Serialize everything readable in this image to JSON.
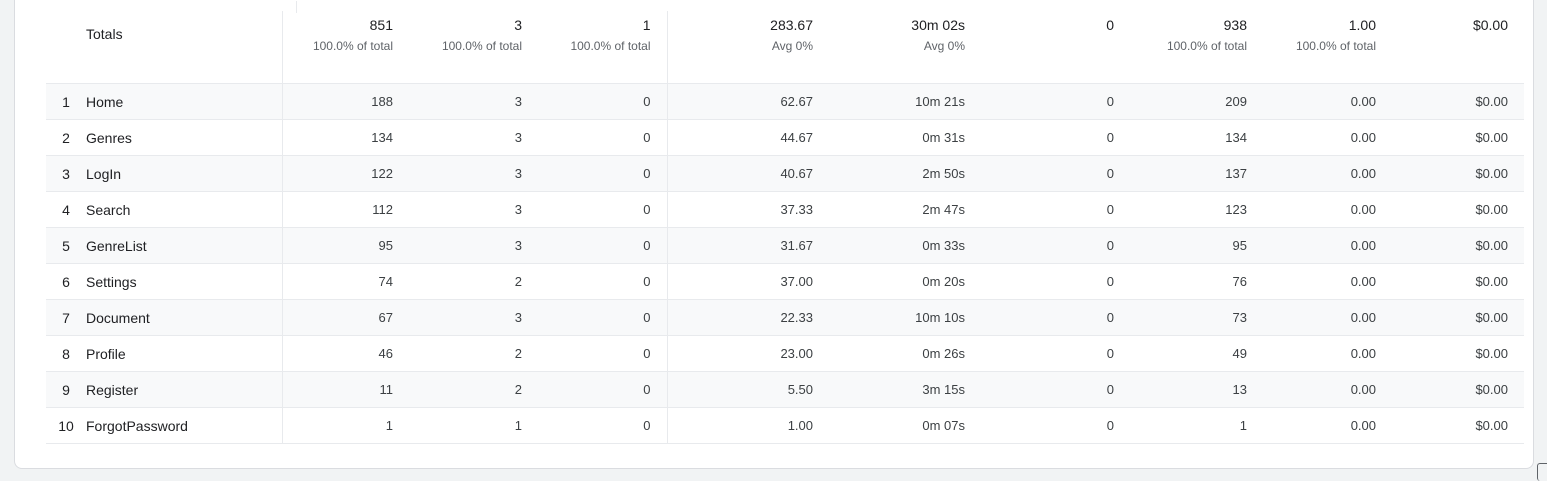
{
  "totals": {
    "label": "Totals",
    "columns": [
      {
        "value": "851",
        "sub": "100.0% of total"
      },
      {
        "value": "3",
        "sub": "100.0% of total"
      },
      {
        "value": "1",
        "sub": "100.0% of total"
      },
      {
        "value": "283.67",
        "sub": "Avg 0%"
      },
      {
        "value": "30m 02s",
        "sub": "Avg 0%"
      },
      {
        "value": "0",
        "sub": ""
      },
      {
        "value": "938",
        "sub": "100.0% of total"
      },
      {
        "value": "1.00",
        "sub": "100.0% of total"
      },
      {
        "value": "$0.00",
        "sub": ""
      }
    ]
  },
  "rows": [
    {
      "rank": "1",
      "name": "Home",
      "values": [
        "188",
        "3",
        "0",
        "62.67",
        "10m 21s",
        "0",
        "209",
        "0.00",
        "$0.00"
      ]
    },
    {
      "rank": "2",
      "name": "Genres",
      "values": [
        "134",
        "3",
        "0",
        "44.67",
        "0m 31s",
        "0",
        "134",
        "0.00",
        "$0.00"
      ]
    },
    {
      "rank": "3",
      "name": "LogIn",
      "values": [
        "122",
        "3",
        "0",
        "40.67",
        "2m 50s",
        "0",
        "137",
        "0.00",
        "$0.00"
      ]
    },
    {
      "rank": "4",
      "name": "Search",
      "values": [
        "112",
        "3",
        "0",
        "37.33",
        "2m 47s",
        "0",
        "123",
        "0.00",
        "$0.00"
      ]
    },
    {
      "rank": "5",
      "name": "GenreList",
      "values": [
        "95",
        "3",
        "0",
        "31.67",
        "0m 33s",
        "0",
        "95",
        "0.00",
        "$0.00"
      ]
    },
    {
      "rank": "6",
      "name": "Settings",
      "values": [
        "74",
        "2",
        "0",
        "37.00",
        "0m 20s",
        "0",
        "76",
        "0.00",
        "$0.00"
      ]
    },
    {
      "rank": "7",
      "name": "Document",
      "values": [
        "67",
        "3",
        "0",
        "22.33",
        "10m 10s",
        "0",
        "73",
        "0.00",
        "$0.00"
      ]
    },
    {
      "rank": "8",
      "name": "Profile",
      "values": [
        "46",
        "2",
        "0",
        "23.00",
        "0m 26s",
        "0",
        "49",
        "0.00",
        "$0.00"
      ]
    },
    {
      "rank": "9",
      "name": "Register",
      "values": [
        "11",
        "2",
        "0",
        "5.50",
        "3m 15s",
        "0",
        "13",
        "0.00",
        "$0.00"
      ]
    },
    {
      "rank": "10",
      "name": "ForgotPassword",
      "values": [
        "1",
        "1",
        "0",
        "1.00",
        "0m 07s",
        "0",
        "1",
        "0.00",
        "$0.00"
      ]
    }
  ]
}
